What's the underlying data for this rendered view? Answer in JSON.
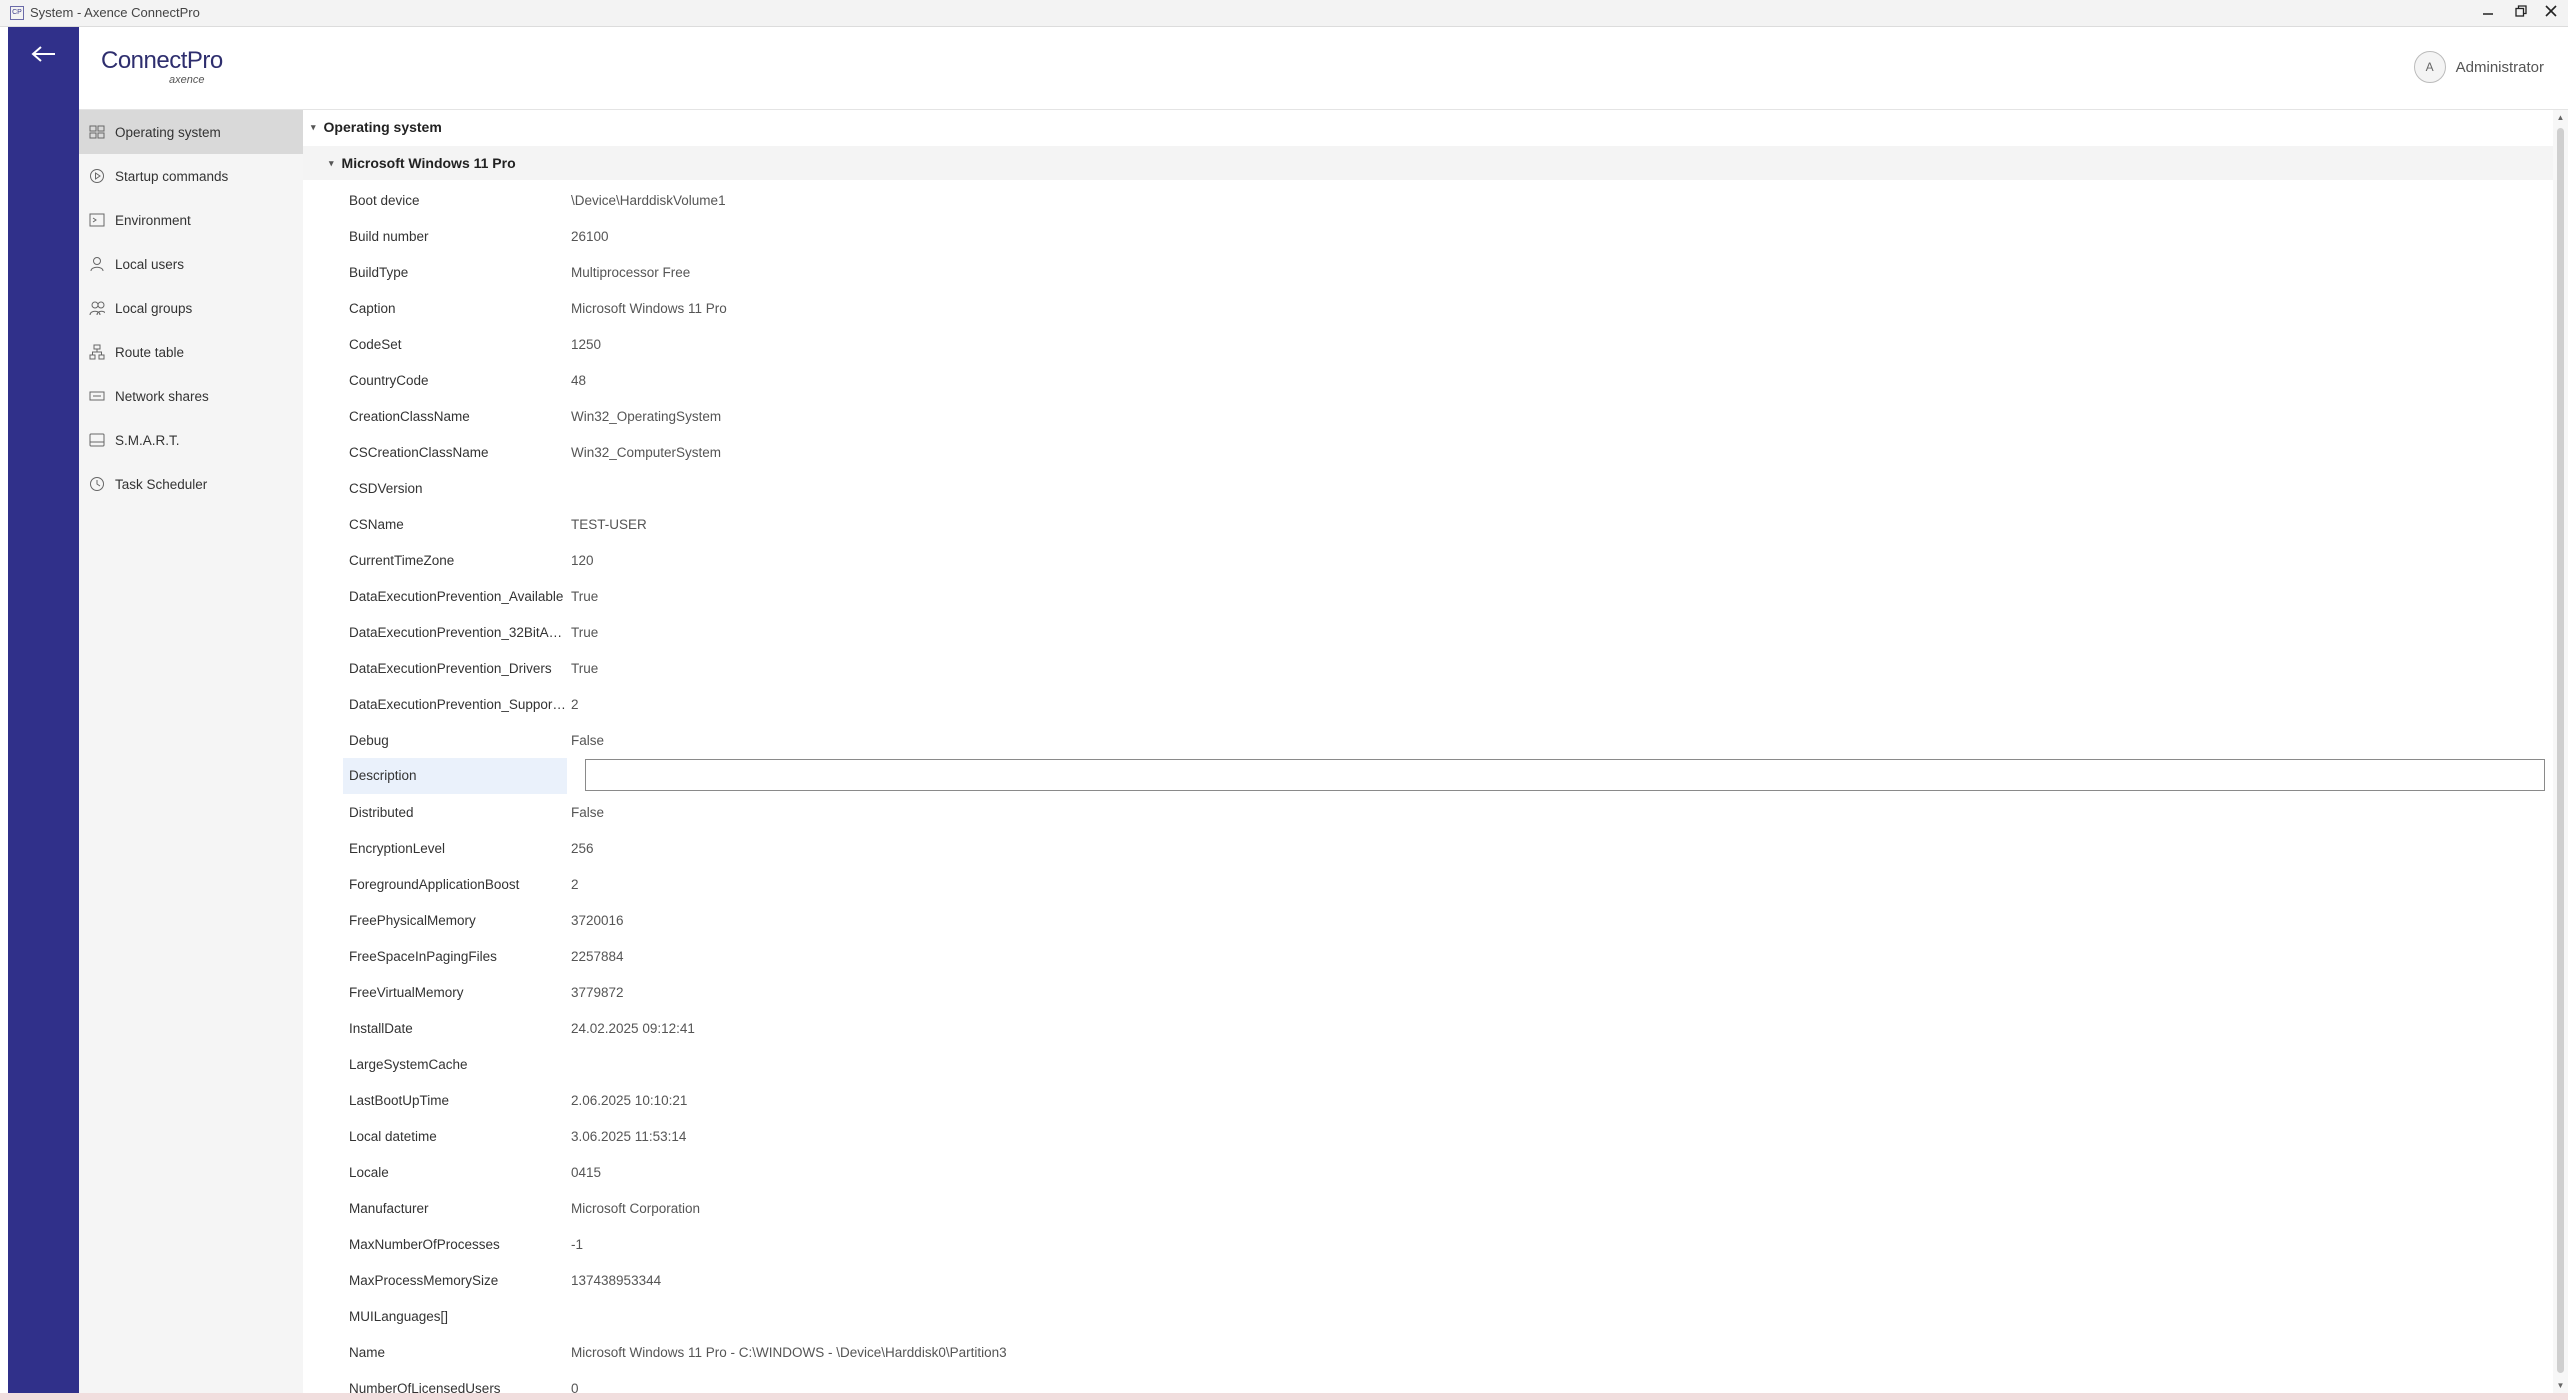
{
  "window": {
    "title": "System - Axence ConnectPro",
    "app_icon": "CP"
  },
  "header": {
    "brand": "ConnectPro",
    "sub": "axence",
    "user_initial": "A",
    "user_name": "Administrator"
  },
  "nav": {
    "items": [
      {
        "label": "Operating system",
        "icon": "os-icon",
        "active": true
      },
      {
        "label": "Startup commands",
        "icon": "play-icon"
      },
      {
        "label": "Environment",
        "icon": "terminal-icon"
      },
      {
        "label": "Local users",
        "icon": "user-icon"
      },
      {
        "label": "Local groups",
        "icon": "group-icon"
      },
      {
        "label": "Route table",
        "icon": "route-icon"
      },
      {
        "label": "Network shares",
        "icon": "share-icon"
      },
      {
        "label": "S.M.A.R.T.",
        "icon": "disk-icon"
      },
      {
        "label": "Task Scheduler",
        "icon": "clock-icon"
      }
    ]
  },
  "main": {
    "section_title": "Operating system",
    "group_title": "Microsoft Windows 11 Pro",
    "properties": [
      {
        "name": "Boot device",
        "value": "\\Device\\HarddiskVolume1"
      },
      {
        "name": "Build number",
        "value": "26100"
      },
      {
        "name": "BuildType",
        "value": "Multiprocessor Free"
      },
      {
        "name": "Caption",
        "value": "Microsoft Windows 11 Pro"
      },
      {
        "name": "CodeSet",
        "value": "1250"
      },
      {
        "name": "CountryCode",
        "value": "48"
      },
      {
        "name": "CreationClassName",
        "value": "Win32_OperatingSystem"
      },
      {
        "name": "CSCreationClassName",
        "value": "Win32_ComputerSystem"
      },
      {
        "name": "CSDVersion",
        "value": ""
      },
      {
        "name": "CSName",
        "value": "TEST-USER"
      },
      {
        "name": "CurrentTimeZone",
        "value": "120"
      },
      {
        "name": "DataExecutionPrevention_Available",
        "value": "True"
      },
      {
        "name": "DataExecutionPrevention_32BitAp...",
        "value": "True"
      },
      {
        "name": "DataExecutionPrevention_Drivers",
        "value": "True"
      },
      {
        "name": "DataExecutionPrevention_Support...",
        "value": "2"
      },
      {
        "name": "Debug",
        "value": "False"
      },
      {
        "name": "Description",
        "value": "",
        "editing": true
      },
      {
        "name": "Distributed",
        "value": "False"
      },
      {
        "name": "EncryptionLevel",
        "value": "256"
      },
      {
        "name": "ForegroundApplicationBoost",
        "value": "2"
      },
      {
        "name": "FreePhysicalMemory",
        "value": "3720016"
      },
      {
        "name": "FreeSpaceInPagingFiles",
        "value": "2257884"
      },
      {
        "name": "FreeVirtualMemory",
        "value": "3779872"
      },
      {
        "name": "InstallDate",
        "value": "24.02.2025 09:12:41"
      },
      {
        "name": "LargeSystemCache",
        "value": ""
      },
      {
        "name": "LastBootUpTime",
        "value": "2.06.2025 10:10:21"
      },
      {
        "name": "Local datetime",
        "value": "3.06.2025 11:53:14"
      },
      {
        "name": "Locale",
        "value": "0415"
      },
      {
        "name": "Manufacturer",
        "value": "Microsoft Corporation"
      },
      {
        "name": "MaxNumberOfProcesses",
        "value": "-1"
      },
      {
        "name": "MaxProcessMemorySize",
        "value": "137438953344"
      },
      {
        "name": "MUILanguages[]",
        "value": ""
      },
      {
        "name": "Name",
        "value": "Microsoft Windows 11 Pro - C:\\WINDOWS - \\Device\\Harddisk0\\Partition3"
      },
      {
        "name": "NumberOfLicensedUsers",
        "value": "0"
      }
    ]
  }
}
